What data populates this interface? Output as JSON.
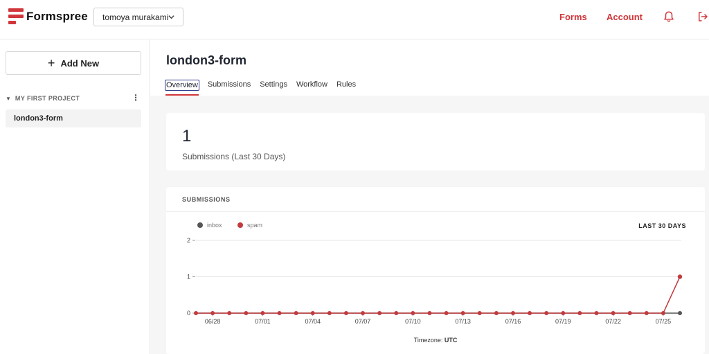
{
  "app": {
    "name": "Formspree"
  },
  "header": {
    "user": "tomoya murakami",
    "nav": [
      "Forms",
      "Account"
    ],
    "brand_color": "#d0363a"
  },
  "sidebar": {
    "add_new": "Add New",
    "project": "MY FIRST PROJECT",
    "forms": [
      "london3-form"
    ]
  },
  "main": {
    "title": "london3-form",
    "tabs": [
      "Overview",
      "Submissions",
      "Settings",
      "Workflow",
      "Rules"
    ],
    "active_tab": "Overview",
    "stat": {
      "value": "1",
      "label": "Submissions (Last 30 Days)"
    },
    "chart_card": {
      "heading": "SUBMISSIONS",
      "range": "LAST 30 DAYS"
    }
  },
  "chart_data": {
    "type": "line",
    "legend": [
      "inbox",
      "spam"
    ],
    "series": [
      {
        "name": "inbox",
        "color": "#555555",
        "values": [
          0,
          0,
          0,
          0,
          0,
          0,
          0,
          0,
          0,
          0,
          0,
          0,
          0,
          0,
          0,
          0,
          0,
          0,
          0,
          0,
          0,
          0,
          0,
          0,
          0,
          0,
          0,
          0,
          0,
          0
        ]
      },
      {
        "name": "spam",
        "color": "#c23b3e",
        "values": [
          0,
          0,
          0,
          0,
          0,
          0,
          0,
          0,
          0,
          0,
          0,
          0,
          0,
          0,
          0,
          0,
          0,
          0,
          0,
          0,
          0,
          0,
          0,
          0,
          0,
          0,
          0,
          0,
          0,
          1
        ]
      }
    ],
    "x_tick_labels": [
      "06/28",
      "07/01",
      "07/04",
      "07/07",
      "07/10",
      "07/13",
      "07/16",
      "07/19",
      "07/22",
      "07/25"
    ],
    "x_tick_start_index": 1,
    "x_tick_step": 3,
    "y_ticks": [
      0,
      1,
      2
    ],
    "ylim": [
      0,
      2
    ],
    "grid": true,
    "timezone_label": "Timezone:",
    "timezone": "UTC"
  }
}
